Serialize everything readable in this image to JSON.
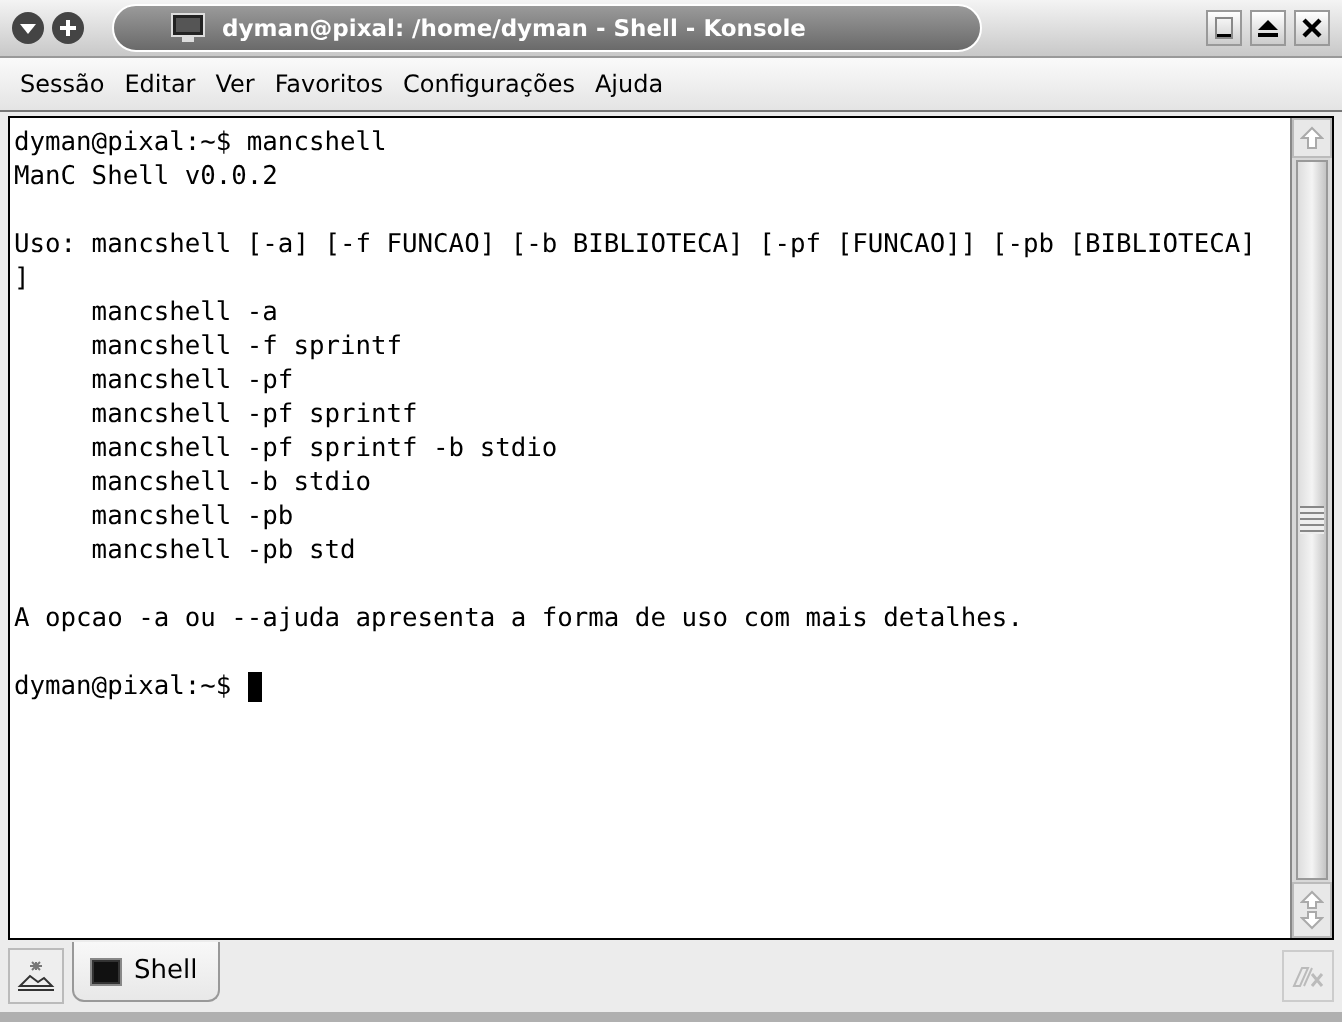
{
  "window": {
    "title": "dyman@pixal: /home/dyman - Shell - Konsole"
  },
  "menu": [
    "Sessão",
    "Editar",
    "Ver",
    "Favoritos",
    "Configurações",
    "Ajuda"
  ],
  "terminal": {
    "blocks": [
      [
        "dyman@pixal:~$ mancshell",
        "ManC Shell v0.0.2"
      ],
      [
        "Uso: mancshell [-a] [-f FUNCAO] [-b BIBLIOTECA] [-pf [FUNCAO]] [-pb [BIBLIOTECA]",
        "]",
        "     mancshell -a",
        "     mancshell -f sprintf",
        "     mancshell -pf",
        "     mancshell -pf sprintf",
        "     mancshell -pf sprintf -b stdio",
        "     mancshell -b stdio",
        "     mancshell -pb",
        "     mancshell -pb std"
      ],
      [
        "A opcao -a ou --ajuda apresenta a forma de uso com mais detalhes."
      ]
    ],
    "prompt": "dyman@pixal:~$",
    "cursor": true
  },
  "tabs": [
    {
      "label": "Shell",
      "selected": true
    }
  ]
}
